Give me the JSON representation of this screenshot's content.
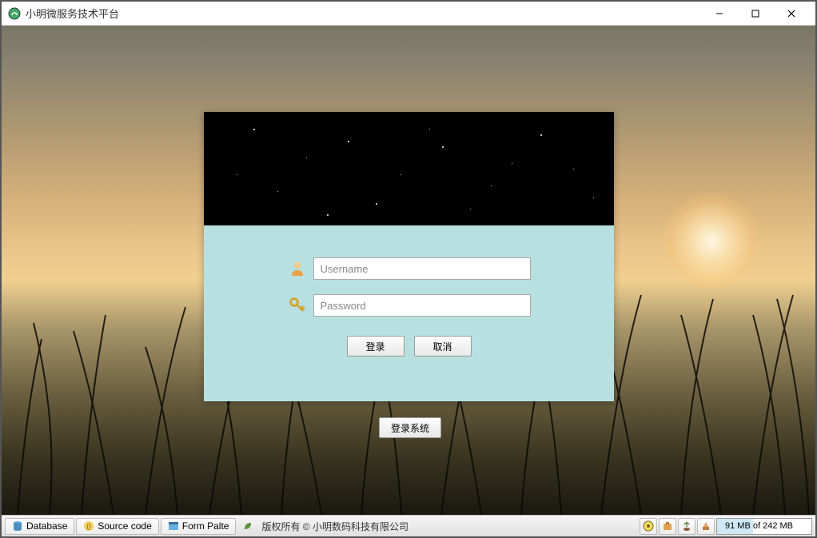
{
  "window": {
    "title": "小明微服务技术平台"
  },
  "login": {
    "username_placeholder": "Username",
    "password_placeholder": "Password",
    "submit_label": "登录",
    "cancel_label": "取消"
  },
  "main": {
    "login_system_label": "登录系统"
  },
  "statusbar": {
    "items": [
      {
        "label": "Database"
      },
      {
        "label": "Source code"
      },
      {
        "label": "Form Palte"
      }
    ],
    "copyright": "版权所有 © 小明数码科技有限公司",
    "memory": "91 MB of 242 MB"
  },
  "colors": {
    "panel_bg": "#b8e0e0",
    "header_bg": "#000000"
  }
}
